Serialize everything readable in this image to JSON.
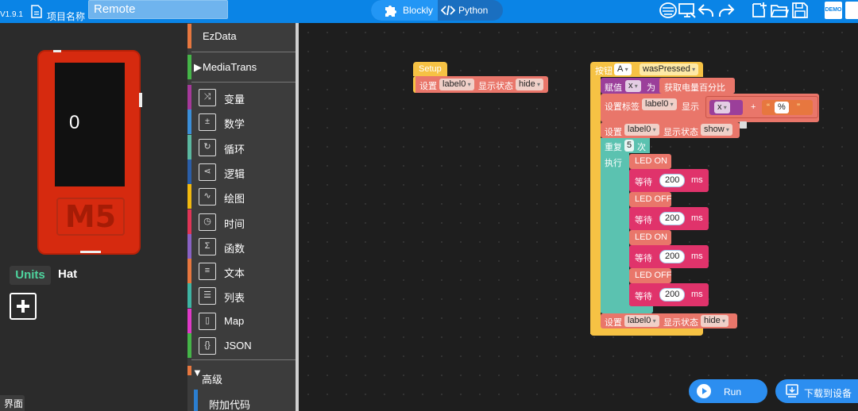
{
  "topbar": {
    "version": "V1.9.1",
    "project_label": "项目名称",
    "project_name": "Remote",
    "mode_blockly": "Blockly",
    "mode_python": "Python",
    "demo_label": "DEMO"
  },
  "device": {
    "screen_text": "0",
    "logo_text": "M5"
  },
  "panel": {
    "tab_units": "Units",
    "tab_hat": "Hat",
    "ui_tab": "界面"
  },
  "toolbox": {
    "ezdata": "EzData",
    "mediatrans": "MediaTrans",
    "categories": [
      {
        "label": "变量",
        "color": "#a5399a",
        "icon": "variable-icon"
      },
      {
        "label": "数学",
        "color": "#3b8fd9",
        "icon": "math-icon"
      },
      {
        "label": "循环",
        "color": "#5bb8a0",
        "icon": "loop-icon"
      },
      {
        "label": "逻辑",
        "color": "#2b5ea8",
        "icon": "logic-icon"
      },
      {
        "label": "绘图",
        "color": "#f2b90f",
        "icon": "draw-icon"
      },
      {
        "label": "时间",
        "color": "#e03557",
        "icon": "time-icon"
      },
      {
        "label": "函数",
        "color": "#8a62c4",
        "icon": "function-icon"
      },
      {
        "label": "文本",
        "color": "#e7773f",
        "icon": "text-icon"
      },
      {
        "label": "列表",
        "color": "#3fb4a3",
        "icon": "list-icon"
      },
      {
        "label": "Map",
        "color": "#e03ac8",
        "icon": "map-icon"
      },
      {
        "label": "JSON",
        "color": "#45b548",
        "icon": "json-icon"
      }
    ],
    "advanced": "高级",
    "extra_code": "附加代码"
  },
  "blocks": {
    "setup": {
      "hat": "Setup",
      "set_label": "设置",
      "label_field": "label0",
      "display_state": "显示状态",
      "state": "hide"
    },
    "event": {
      "button": "按钮",
      "button_id": "A",
      "event_name": "wasPressed",
      "assign": "赋值",
      "var_x": "x",
      "as": "为",
      "battery": "获取电量百分比",
      "set_label_text": "设置标签",
      "label_field": "label0",
      "show": "显示",
      "plus": "+",
      "percent": "%",
      "set": "设置",
      "display_state": "显示状态",
      "state_show": "show",
      "repeat": "重复",
      "repeat_count": "5",
      "times": "次",
      "do": "执行",
      "led_on": "LED ON",
      "led_off": "LED OFF",
      "wait": "等待",
      "ms": "ms",
      "wait_value": "200",
      "state_hide": "hide"
    }
  },
  "actions": {
    "run": "Run",
    "download": "下载到设备"
  }
}
